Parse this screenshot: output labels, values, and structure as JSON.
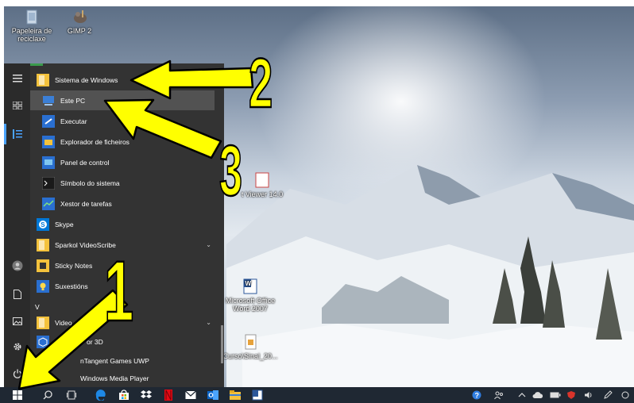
{
  "desktop": {
    "icons": [
      {
        "label": "Papeleira de reciclaxe"
      },
      {
        "label": "GIMP 2"
      },
      {
        "label": "t Viewer 14.0"
      },
      {
        "label": "Microsoft Office Word 2007"
      },
      {
        "label": "Curso\\Sinal_20..."
      }
    ]
  },
  "start_menu": {
    "group_header": "Sistema de Windows",
    "items": [
      {
        "label": "Este PC"
      },
      {
        "label": "Executar"
      },
      {
        "label": "Explorador de ficheiros"
      },
      {
        "label": "Panel de control"
      },
      {
        "label": "Símbolo do sistema"
      },
      {
        "label": "Xestor de tarefas"
      },
      {
        "label": "Skype"
      },
      {
        "label": "Sparkol VideoScribe"
      },
      {
        "label": "Sticky Notes"
      },
      {
        "label": "Suxestións"
      },
      {
        "label": "V"
      },
      {
        "label": "Video"
      },
      {
        "label": "or 3D"
      },
      {
        "label": "nTangent Games UWP"
      },
      {
        "label": "Windows Media Player"
      }
    ]
  },
  "annotations": {
    "one": "1",
    "two": "2",
    "three": "3"
  },
  "colors": {
    "menu_bg": "#333333",
    "rail_bg": "#2b2b2b",
    "taskbar_bg": "#1f2833",
    "annotation_fill": "#ffff00",
    "selection_bg": "#525252"
  }
}
